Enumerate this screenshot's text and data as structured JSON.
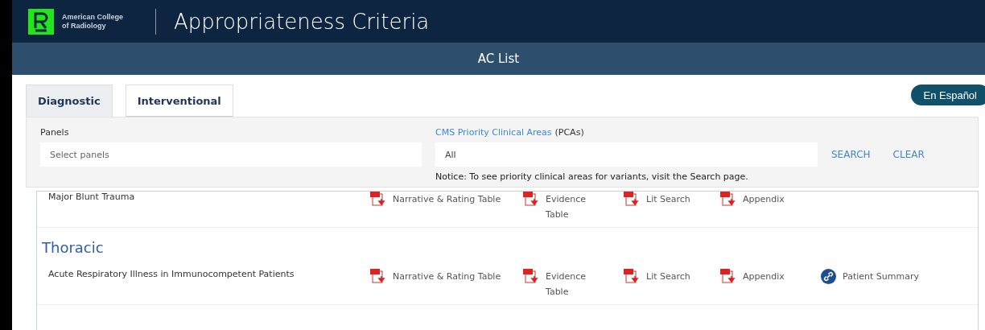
{
  "header": {
    "org_line_1": "American College",
    "org_line_2": "of Radiology",
    "title": "Appropriateness Criteria"
  },
  "subheader": {
    "title": "AC List"
  },
  "tabs": [
    {
      "label": "Diagnostic",
      "selected": true
    },
    {
      "label": "Interventional",
      "selected": false
    }
  ],
  "language_button": "En Español",
  "filters": {
    "panels_label": "Panels",
    "panels_placeholder": "Select panels",
    "pca_link": "CMS Priority Clinical Areas",
    "pca_suffix": "(PCAs)",
    "pca_value": "All",
    "search": "SEARCH",
    "clear": "CLEAR",
    "notice": "Notice: To see priority clinical areas for variants, visit the Search page."
  },
  "sections": [
    {
      "rows": [
        {
          "topic": "Major Blunt Trauma",
          "links": [
            {
              "kind": "pdf",
              "label": "Narrative & Rating Table"
            },
            {
              "kind": "pdf",
              "label": "Evidence Table"
            },
            {
              "kind": "pdf",
              "label": "Lit Search"
            },
            {
              "kind": "pdf",
              "label": "Appendix"
            }
          ]
        }
      ]
    },
    {
      "heading": "Thoracic",
      "rows": [
        {
          "topic": "Acute Respiratory Illness in Immunocompetent Patients",
          "links": [
            {
              "kind": "pdf",
              "label": "Narrative & Rating Table"
            },
            {
              "kind": "pdf",
              "label": "Evidence Table"
            },
            {
              "kind": "pdf",
              "label": "Lit Search"
            },
            {
              "kind": "pdf",
              "label": "Appendix"
            },
            {
              "kind": "link",
              "label": "Patient Summary"
            }
          ]
        }
      ]
    }
  ]
}
